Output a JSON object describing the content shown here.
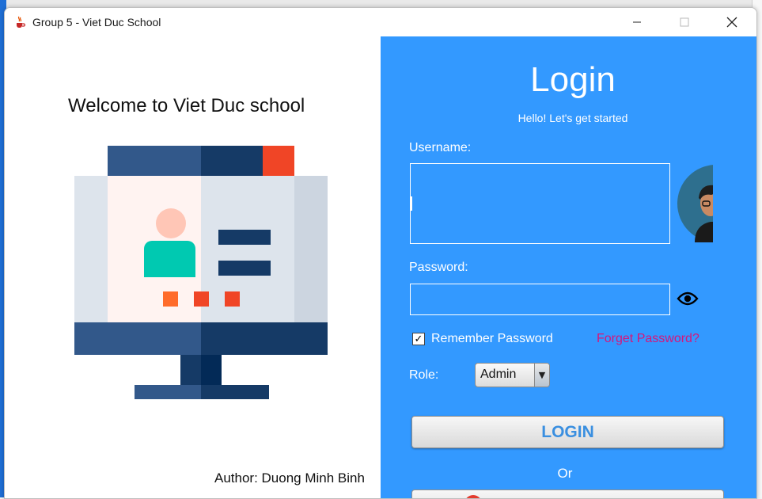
{
  "window": {
    "title": "Group 5 - Viet Duc School",
    "app_icon": "java-cup-icon",
    "controls": [
      "minimize-icon",
      "maximize-icon",
      "close-icon"
    ]
  },
  "left": {
    "welcome": "Welcome to Viet Duc school",
    "illustration": "computer-monitor-profile-icon",
    "author": "Author: Duong Minh Binh"
  },
  "login": {
    "title": "Login",
    "subtitle": "Hello! Let's get started",
    "username_label": "Username:",
    "username_value": "",
    "password_label": "Password:",
    "password_value": "",
    "show_password_icon": "eye-icon",
    "avatar_icon": "user-avatar-icon",
    "remember": {
      "label": "Remember Password",
      "checked": true,
      "check_glyph": "✓"
    },
    "forget_label": "Forget Password?",
    "role_label": "Role:",
    "role_value": "Admin",
    "role_arrow": "▼",
    "login_button": "LOGIN",
    "or_text": "Or",
    "google_icon": "google-icon"
  },
  "colors": {
    "panel_blue": "#3399ff",
    "link_pink": "#d6167a",
    "login_text": "#3a8fe0"
  }
}
